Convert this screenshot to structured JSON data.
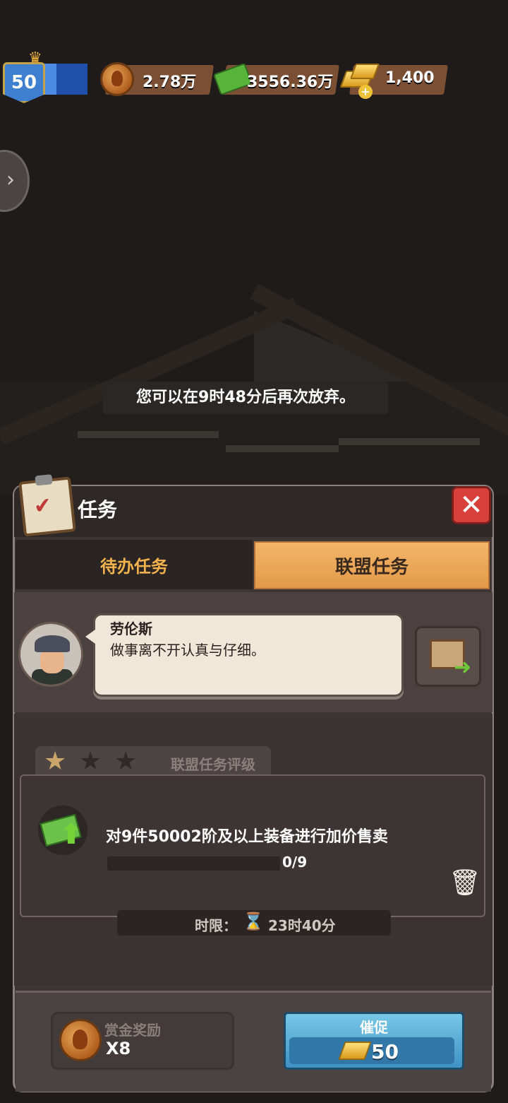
{
  "hud": {
    "level": "50",
    "coins": "2.78万",
    "cash": "3556.36万",
    "gold": "1,400"
  },
  "toast": "您可以在9时48分后再次放弃。",
  "panel": {
    "title": "任务",
    "tabs": [
      {
        "label": "待办任务",
        "active": false
      },
      {
        "label": "联盟任务",
        "active": true
      }
    ],
    "npc": {
      "name": "劳伦斯",
      "line": "做事离不开认真与仔细。"
    },
    "quest": {
      "rating_label": "联盟任务评级",
      "stars_filled": 1,
      "stars_total": 3,
      "description": "对9件50002阶及以上装备进行加价售卖",
      "progress": "0/9",
      "progress_fraction": 0,
      "time_label": "时限：",
      "time_value": "23时40分"
    },
    "reward": {
      "label": "赏金奖励",
      "value": "X8"
    },
    "urge": {
      "label": "催促",
      "cost": "50"
    }
  },
  "colors": {
    "tab_active": "#e39a48",
    "tab_inactive_text": "#f2b34e",
    "close_button": "#d8403b",
    "urge_button": "#3f92c4"
  }
}
